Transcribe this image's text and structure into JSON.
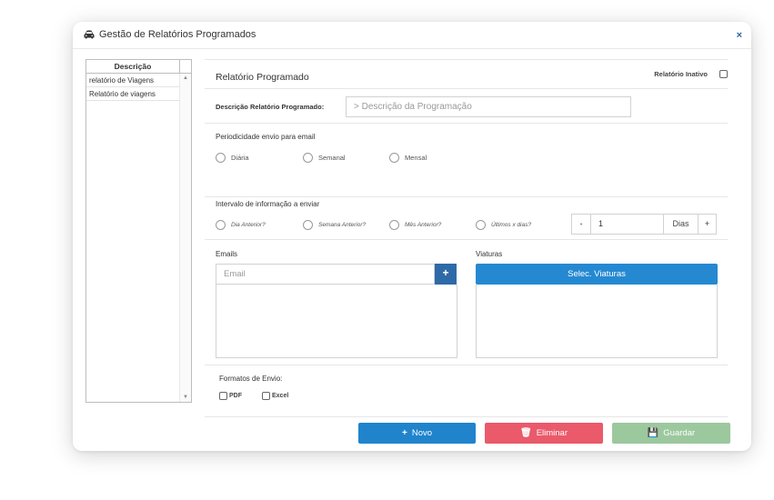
{
  "window": {
    "title": "Gestão de Relatórios Programados",
    "close": "×",
    "icon": "car-icon"
  },
  "list": {
    "header": "Descrição",
    "items": [
      {
        "label": "relatório de Viagens"
      },
      {
        "label": "Relatório de viagens"
      }
    ],
    "scroll_up": "▲",
    "scroll_down": "▼"
  },
  "form": {
    "title": "Relatório Programado",
    "inactive_label": "Relatório Inativo",
    "desc_label": "Descrição Relatório Programado:",
    "desc_placeholder": "> Descrição da Programação",
    "period": {
      "label": "Periodicidade envio para email",
      "options": [
        "Diária",
        "Semanal",
        "Mensal"
      ]
    },
    "interval": {
      "label": "Intervalo de informação a enviar",
      "options": [
        "Dia Anterior?",
        "Semana Anterior?",
        "Mês Anterior?",
        "Últimos x dias?"
      ],
      "minus": "-",
      "value": "1",
      "unit": "Dias",
      "plus": "+"
    },
    "emails": {
      "label": "Emails",
      "placeholder": "Email",
      "add": "+"
    },
    "viaturas": {
      "label": "Viaturas",
      "button": "Selec. Viaturas"
    },
    "formats": {
      "label": "Formatos de Envio:",
      "pdf": "PDF",
      "excel": "Excel"
    }
  },
  "buttons": {
    "new": "Novo",
    "new_icon": "+",
    "delete": "Eliminar",
    "delete_icon": "🗑",
    "save": "Guardar",
    "save_icon": "💾"
  },
  "colors": {
    "primary": "#2084cc",
    "danger": "#ea5a6b",
    "success": "#9cc89e",
    "dark_blue": "#2f6aa8"
  }
}
